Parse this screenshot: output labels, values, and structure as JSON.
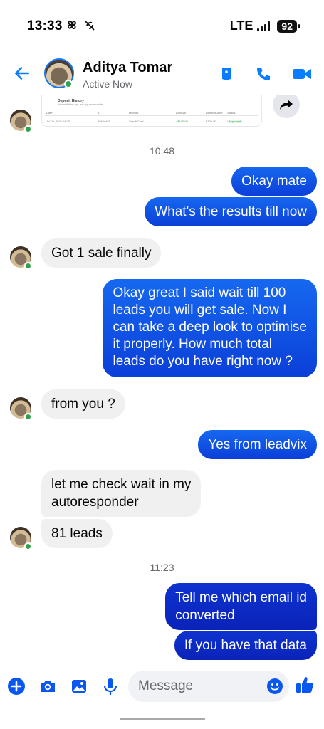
{
  "status_bar": {
    "time": "13:33",
    "network": "LTE",
    "battery": "92"
  },
  "header": {
    "contact_name": "Aditya Tomar",
    "contact_status": "Active Now"
  },
  "preview_card": {
    "title": "Deposit History",
    "subtitle": "Your wallet top-ups and app store credits",
    "columns": [
      "Date",
      "ID",
      "Method",
      "Amount",
      "Balance After",
      "Status"
    ],
    "row": [
      "Jul 05, 2025 04:20",
      "9865a4d3",
      "Credit Card",
      "+$100.00",
      "$100.00",
      "Approved"
    ]
  },
  "messages": {
    "ts1": "10:48",
    "m1": "Okay mate",
    "m2": "What's the results till now",
    "m3": "Got 1 sale finally",
    "m4_l1": "Okay great I said wait till 100",
    "m4_l2": "leads you will get sale. Now I",
    "m4_l3": "can take a deep look to optimise",
    "m4_l4": "it properly. How much total",
    "m4_l5": "leads do you have right now ?",
    "m5": "from you ?",
    "m6": "Yes from leadvix",
    "m7_l1": "let me check wait in my",
    "m7_l2": "autoresponder",
    "m8": "81 leads",
    "ts2": "11:23",
    "m9_l1": "Tell me which email id",
    "m9_l2": "converted",
    "m10": "If you have that data"
  },
  "composer": {
    "placeholder": "Message"
  },
  "colors": {
    "messenger_blue": "#0b57f0",
    "online_green": "#31a24c",
    "incoming_bubble": "#f0f0f0"
  }
}
